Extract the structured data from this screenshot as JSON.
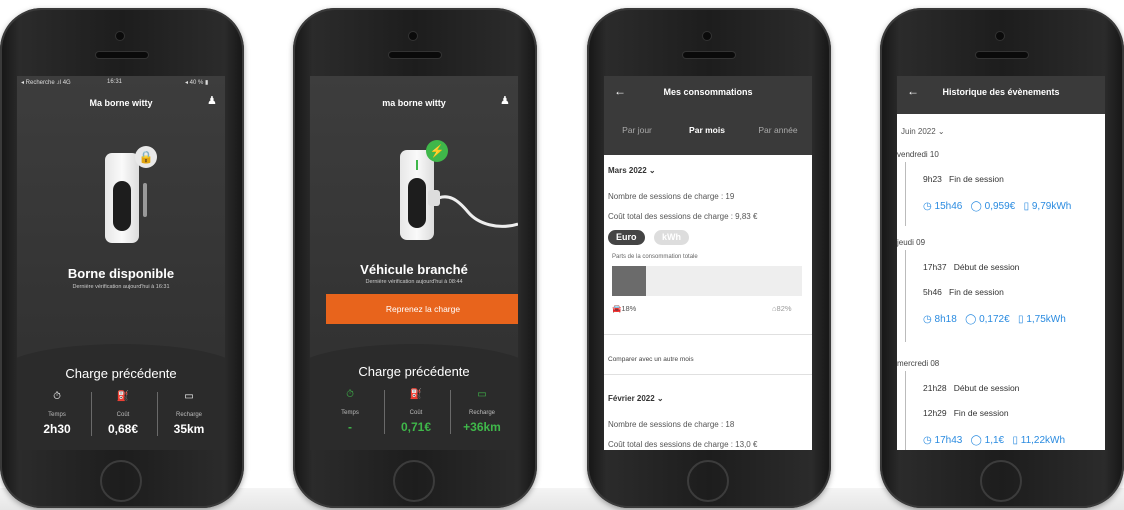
{
  "phone1": {
    "status": {
      "left": "◂ Recherche .ıl 4G",
      "time": "16:31",
      "right": "◂ 40 % ▮"
    },
    "title": "Ma borne witty",
    "user_icon": "user-icon",
    "main_status": "Borne disponible",
    "sub_status": "Dernière vérification aujourd'hui à 16:31",
    "section_title": "Charge précédente",
    "stats": [
      {
        "icon": "timer-icon",
        "glyph": "⏱",
        "label": "Temps",
        "value": "2h30"
      },
      {
        "icon": "cost-icon",
        "glyph": "⛽",
        "label": "Coût",
        "value": "0,68€"
      },
      {
        "icon": "battery-icon",
        "glyph": "▭",
        "label": "Recharge",
        "value": "35km"
      }
    ]
  },
  "phone2": {
    "title": "ma borne witty",
    "main_status": "Véhicule branché",
    "sub_status": "Dernière vérification aujourd'hui à 08:44",
    "action_button": "Reprenez la charge",
    "section_title": "Charge précédente",
    "stats": [
      {
        "icon": "timer-icon",
        "glyph": "⏱",
        "label": "Temps",
        "value": "-"
      },
      {
        "icon": "cost-icon",
        "glyph": "⛽",
        "label": "Coût",
        "value": "0,71€"
      },
      {
        "icon": "battery-icon",
        "glyph": "▭",
        "label": "Recharge",
        "value": "+36km"
      }
    ],
    "accent_color": "#e8641c",
    "green_color": "#3fb74a"
  },
  "phone3": {
    "back": "←",
    "title": "Mes consommations",
    "tabs": [
      "Par jour",
      "Par mois",
      "Par année"
    ],
    "month1": "Mars 2022 ⌄",
    "sessions_line": "Nombre de sessions de charge : 19",
    "cost_line": "Coût total des sessions de charge : 9,83 €",
    "toggle_euro": "Euro",
    "toggle_kwh": "kWh",
    "share_label": "Parts de la consommation totale",
    "share_car_pct": 18,
    "car_label": "18%",
    "home_label": "82%",
    "compare_link": "Comparer avec un autre mois",
    "month2": "Février 2022 ⌄",
    "sessions_line2": "Nombre de sessions de charge : 18",
    "cost_line2": "Coût total des sessions de charge : 13,0 €"
  },
  "phone4": {
    "back": "←",
    "title": "Historique des évènements",
    "month": "Juin 2022 ⌄",
    "days": [
      {
        "day": "vendredi 10",
        "events": [
          {
            "time": "9h23",
            "text": "Fin de session"
          }
        ],
        "stats": [
          "15h46",
          "0,959€",
          "9,79kWh"
        ]
      },
      {
        "day": "jeudi 09",
        "events": [
          {
            "time": "17h37",
            "text": "Début de session"
          },
          {
            "time": "5h46",
            "text": "Fin de session"
          }
        ],
        "stats": [
          "8h18",
          "0,172€",
          "1,75kWh"
        ]
      },
      {
        "day": "mercredi 08",
        "events": [
          {
            "time": "21h28",
            "text": "Début de session"
          },
          {
            "time": "12h29",
            "text": "Fin de session"
          }
        ],
        "stats": [
          "17h43",
          "1,1€",
          "11,22kWh"
        ]
      }
    ]
  }
}
